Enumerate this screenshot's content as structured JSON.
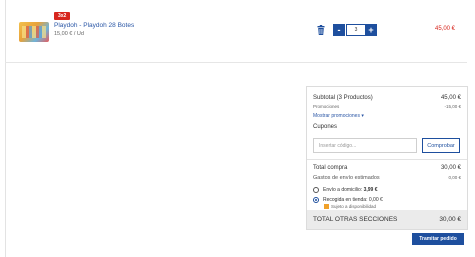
{
  "product": {
    "badge": "3x2",
    "name": "Playdoh - Playdoh 28 Botes",
    "unit_price": "15,00 € / Ud",
    "quantity": "3",
    "line_total": "45,00 €",
    "minus": "-",
    "plus": "+"
  },
  "summary": {
    "subtotal_label": "Subtotal (3 Productos)",
    "subtotal_value": "45,00 €",
    "promos_label": "Promociones",
    "promos_value": "-15,00 €",
    "show_promos": "Mostrar promociones  ▾",
    "coupons_label": "Cupones",
    "coupon_placeholder": "Insertar código...",
    "coupon_button": "Comprobar",
    "total_label": "Total compra",
    "total_value": "30,00 €",
    "shipping_label": "Gastos de envío estimados",
    "shipping_value": "0,00 €",
    "option_home": "Envío a domicilio: ",
    "option_home_price": "3,99 €",
    "option_store": "Recogida en tienda: 0,00 €",
    "availability": "Sujeto a disponibilidad",
    "sections_total_label": "TOTAL OTRAS SECCIONES",
    "sections_total_value": "30,00 €"
  },
  "checkout_button": "Tramitar pedido",
  "colors": {
    "accent": "#1e4f9e",
    "sale_red": "#d7261e"
  }
}
